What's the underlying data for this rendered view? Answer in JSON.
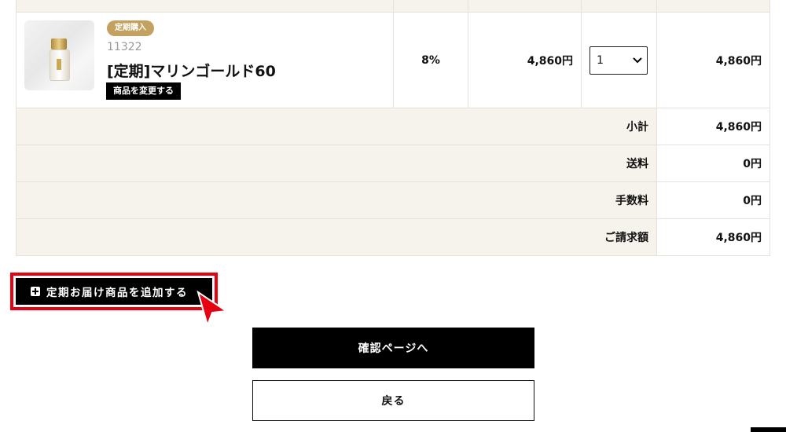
{
  "product": {
    "badge": "定期購入",
    "code": "11322",
    "name": "[定期]マリンゴールド60",
    "change_button": "商品を変更する",
    "image_icon": "product-bottle",
    "tax_rate": "8%",
    "unit_price": "4,860円",
    "quantity": "1",
    "line_total": "4,860円"
  },
  "summary": [
    {
      "label": "小計",
      "value": "4,860円"
    },
    {
      "label": "送料",
      "value": "0円"
    },
    {
      "label": "手数料",
      "value": "0円"
    },
    {
      "label": "ご請求額",
      "value": "4,860円"
    }
  ],
  "actions": {
    "add_subscription_item": "定期お届け商品を追加する",
    "confirm": "確認ページへ",
    "back": "戻る"
  },
  "colors": {
    "accent_highlight": "#e60012",
    "badge_gold": "#c3a160",
    "table_beige": "#f6f3ed"
  },
  "icons": [
    "plus-square-icon",
    "mouse-pointer-icon",
    "chevron-down-icon"
  ]
}
